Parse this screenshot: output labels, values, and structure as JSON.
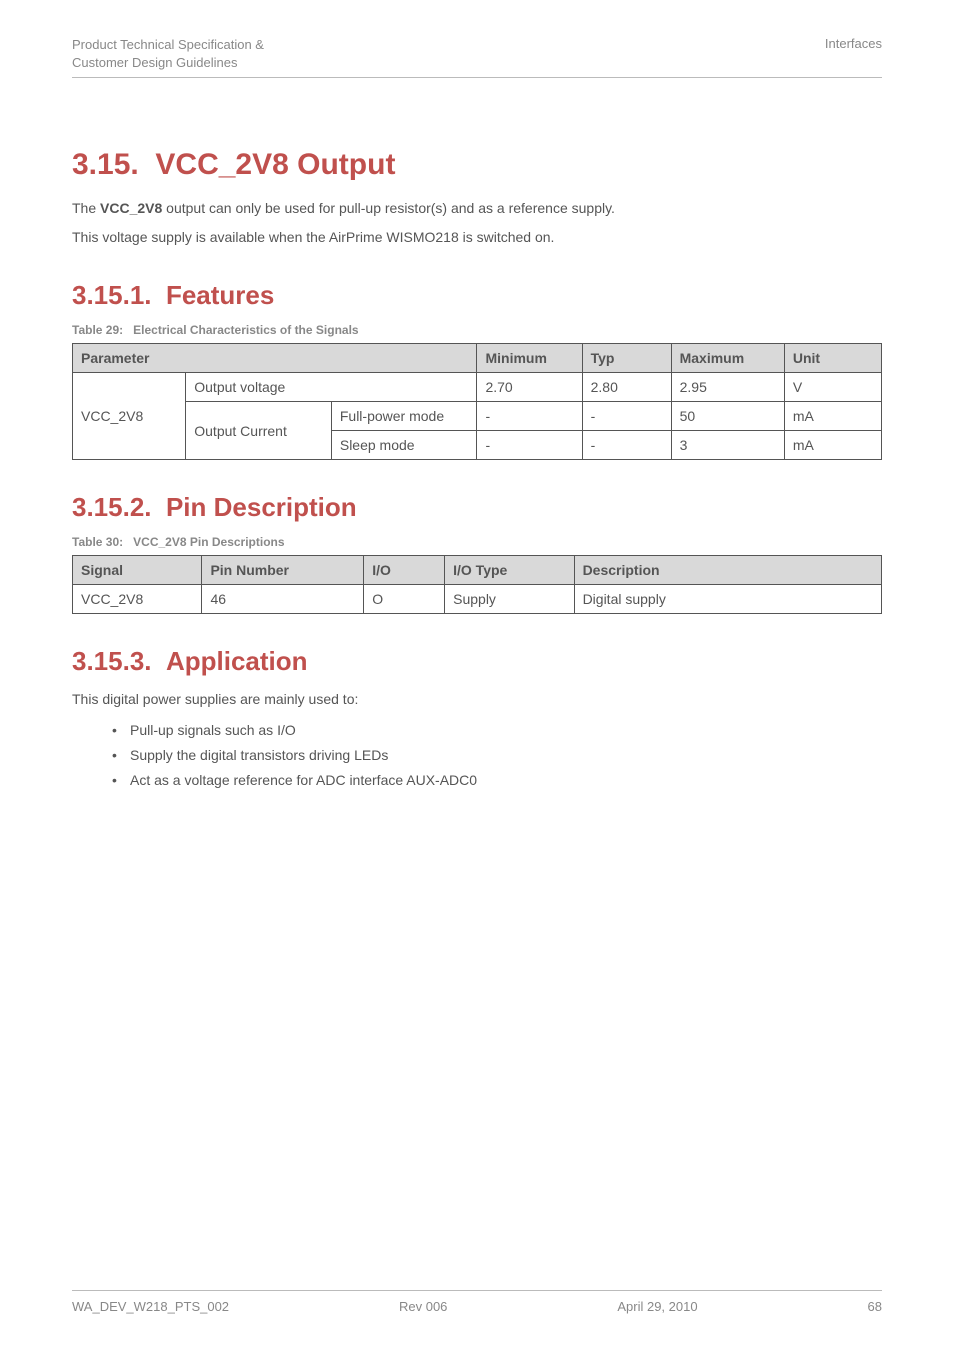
{
  "header": {
    "left_line1": "Product Technical Specification &",
    "left_line2": "Customer Design Guidelines",
    "right": "Interfaces"
  },
  "s315": {
    "number": "3.15.",
    "title": "VCC_2V8 Output",
    "p1_pre": "The ",
    "p1_bold": "VCC_2V8",
    "p1_post": " output can only be used for pull-up resistor(s) and as a reference supply.",
    "p2": "This voltage supply is available when the AirPrime WISMO218 is switched on."
  },
  "s3151": {
    "number": "3.15.1.",
    "title": "Features",
    "caption_label": "Table 29:",
    "caption_text": "Electrical Characteristics of the Signals",
    "th": {
      "param": "Parameter",
      "min": "Minimum",
      "typ": "Typ",
      "max": "Maximum",
      "unit": "Unit"
    },
    "r1": {
      "c1": "VCC_2V8",
      "c2": "Output voltage",
      "min": "2.70",
      "typ": "2.80",
      "max": "2.95",
      "unit": "V"
    },
    "r2": {
      "c2": "Output Current",
      "c3": "Full-power mode",
      "min": "-",
      "typ": "-",
      "max": "50",
      "unit": "mA"
    },
    "r3": {
      "c3": "Sleep mode",
      "min": "-",
      "typ": "-",
      "max": "3",
      "unit": "mA"
    }
  },
  "s3152": {
    "number": "3.15.2.",
    "title": "Pin Description",
    "caption_label": "Table 30:",
    "caption_text": "VCC_2V8 Pin Descriptions",
    "th": {
      "signal": "Signal",
      "pin": "Pin Number",
      "io": "I/O",
      "iotype": "I/O Type",
      "desc": "Description"
    },
    "r1": {
      "signal": "VCC_2V8",
      "pin": "46",
      "io": "O",
      "iotype": "Supply",
      "desc": "Digital supply"
    }
  },
  "s3153": {
    "number": "3.15.3.",
    "title": "Application",
    "intro": "This digital power supplies are mainly used to:",
    "b1": "Pull-up signals such as I/O",
    "b2": "Supply the digital transistors driving LEDs",
    "b3": "Act as a voltage reference for ADC interface AUX-ADC0"
  },
  "footer": {
    "left": "WA_DEV_W218_PTS_002",
    "center": "Rev 006",
    "right_date": "April 29, 2010",
    "right_page": "68"
  }
}
